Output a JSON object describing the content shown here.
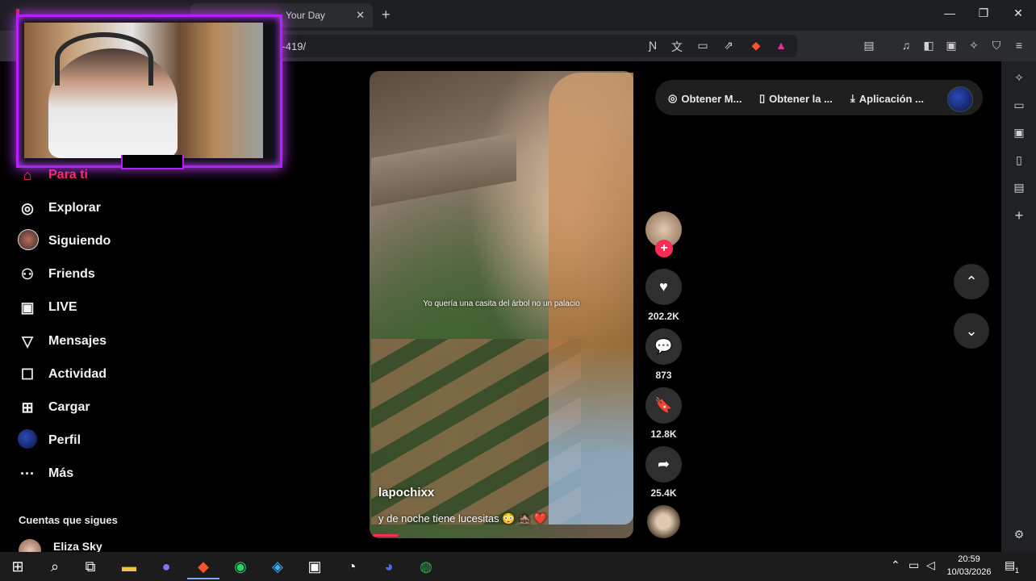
{
  "browser": {
    "tab1_title": "",
    "tab2_title": "Your Day",
    "tab_close": "✕",
    "new_tab": "+",
    "url": "/...-419/",
    "minimize": "—",
    "maximize": "❐",
    "close": "✕"
  },
  "sidebar": {
    "items": [
      {
        "label": "Para ti",
        "icon": "home-icon"
      },
      {
        "label": "Explorar",
        "icon": "compass-icon"
      },
      {
        "label": "Siguiendo",
        "icon": "following-avatar-icon"
      },
      {
        "label": "Friends",
        "icon": "friends-icon"
      },
      {
        "label": "LIVE",
        "icon": "live-tv-icon"
      },
      {
        "label": "Mensajes",
        "icon": "send-icon"
      },
      {
        "label": "Actividad",
        "icon": "activity-icon"
      },
      {
        "label": "Cargar",
        "icon": "upload-plus-icon"
      },
      {
        "label": "Perfil",
        "icon": "profile-avatar-icon"
      },
      {
        "label": "Más",
        "icon": "more-dots-icon"
      }
    ],
    "glyphs": [
      "⌂",
      "◎",
      "",
      "⚇",
      "▣",
      "▽",
      "☐",
      "⊞",
      "",
      "···"
    ],
    "following_header": "Cuentas que sigues",
    "following_accounts": [
      {
        "name": "Eliza Sky"
      }
    ]
  },
  "video": {
    "overlay_text": "Yo quería una casita del árbol no un palacio",
    "author": "lapochixx",
    "description": "y de noche tiene lucesitas 😳 🏚️ ❤️"
  },
  "actions": {
    "follow_glyph": "+",
    "like_glyph": "♥",
    "likes": "202.2K",
    "comment_glyph": "💬",
    "comments": "873",
    "save_glyph": "🔖",
    "saves": "12.8K",
    "share_glyph": "➦",
    "shares": "25.4K"
  },
  "get_bar": {
    "item1": "Obtener M...",
    "item2": "Obtener la ...",
    "item3": "Aplicación ...",
    "icon1": "◎",
    "icon2": "▯",
    "icon3": "⤓"
  },
  "nav_arrows": {
    "up": "⌃",
    "down": "⌄"
  },
  "taskbar": {
    "time": "20:59",
    "date": "10/03/2026",
    "start": "⊞",
    "search": "⌕",
    "taskview": "⧉",
    "tray_chevron": "⌃",
    "notification_count": "1"
  },
  "colors": {
    "accent": "#fe2c55",
    "webcam_frame": "#b620ff"
  }
}
